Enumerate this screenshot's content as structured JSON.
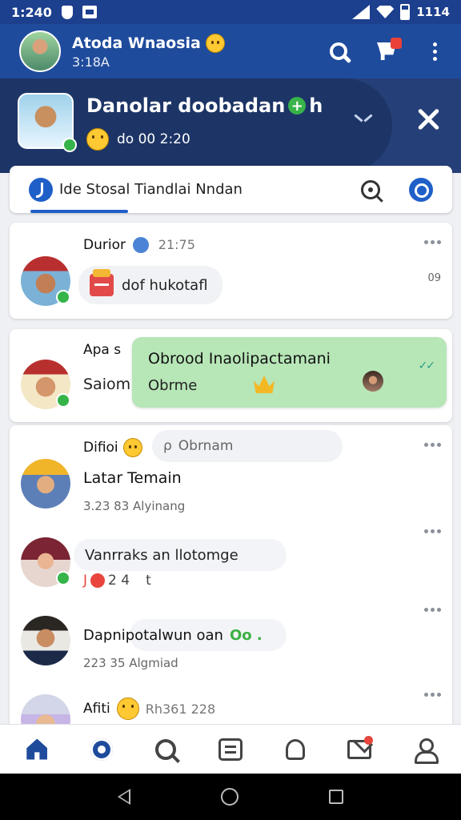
{
  "status_bar": {
    "time": "1:240",
    "battery": "1114"
  },
  "header": {
    "name": "Atoda Wnaosia",
    "subtitle": "3:18A"
  },
  "banner": {
    "title": "Danolar doobadan",
    "subtitle": "do 00 2:20"
  },
  "tab": {
    "label": "Ide Stosal Tiandlai Nndan"
  },
  "feed": {
    "item1": {
      "name": "Durior",
      "time": "21:75",
      "message": "dof hukotafl",
      "side": "09"
    },
    "item2": {
      "name": "Apa s",
      "preview": "Saiom",
      "bubble_title": "Obrood Inaolipactamani",
      "bubble_sub": "Obrme"
    },
    "item3": {
      "name": "Difioi",
      "pill": "Obrnam",
      "title": "Latar Temain",
      "meta": "3.23 83 Alyinang"
    },
    "item4": {
      "title": "Vanrraks an llotomge",
      "reactions": "2 4",
      "reaction_suffix": "t"
    },
    "item5": {
      "title": "Dapnipotalwun oan",
      "dots": "Oo .",
      "meta": "223 35 Algmiad"
    },
    "item6": {
      "name": "Afiti",
      "meta": "Rh361 228"
    }
  },
  "colors": {
    "primary": "#1f4b9c",
    "accent_green": "#b7e6b7",
    "badge_red": "#e8453c"
  }
}
